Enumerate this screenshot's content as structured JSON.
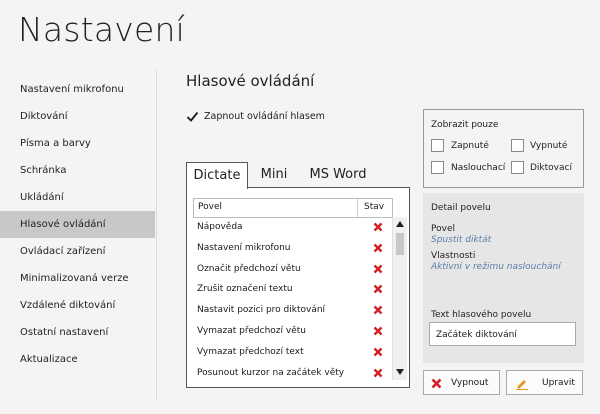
{
  "title": "Nastavení",
  "sidebar": {
    "items": [
      {
        "label": "Nastavení mikrofonu"
      },
      {
        "label": "Diktování"
      },
      {
        "label": "Písma a barvy"
      },
      {
        "label": "Schránka"
      },
      {
        "label": "Ukládání"
      },
      {
        "label": "Hlasové ovládání",
        "active": true
      },
      {
        "label": "Ovládací zařízení"
      },
      {
        "label": "Minimalizovaná verze"
      },
      {
        "label": "Vzdálené diktování"
      },
      {
        "label": "Ostatní nastavení"
      },
      {
        "label": "Aktualizace"
      }
    ]
  },
  "main": {
    "heading": "Hlasové ovládání",
    "enable_voice_label": "Zapnout ovládání hlasem",
    "enable_voice_checked": true,
    "tabs": [
      {
        "label": "Dictate",
        "active": true
      },
      {
        "label": "Mini"
      },
      {
        "label": "MS Word"
      }
    ],
    "table": {
      "columns": [
        "Povel",
        "Stav"
      ],
      "rows": [
        {
          "command": "Nápověda",
          "status": "disabled"
        },
        {
          "command": "Nastavení mikrofonu",
          "status": "disabled"
        },
        {
          "command": "Označit předchozí větu",
          "status": "disabled"
        },
        {
          "command": "Zrušit označení textu",
          "status": "disabled"
        },
        {
          "command": "Nastavit pozici pro diktování",
          "status": "disabled"
        },
        {
          "command": "Vymazat předchozí větu",
          "status": "disabled"
        },
        {
          "command": "Vymazat předchozí text",
          "status": "disabled"
        },
        {
          "command": "Posunout kurzor na začátek věty",
          "status": "disabled"
        }
      ]
    }
  },
  "filter": {
    "title": "Zobrazit pouze",
    "options": [
      {
        "label": "Zapnuté"
      },
      {
        "label": "Vypnuté"
      },
      {
        "label": "Naslouchací"
      },
      {
        "label": "Diktovací"
      }
    ]
  },
  "detail": {
    "title": "Detail povelu",
    "command_label": "Povel",
    "command_value": "Spustit diktát",
    "props_label": "Vlastnosti",
    "props_value": "Aktivní v režimu naslouchání",
    "text_label": "Text hlasového povelu",
    "text_value": "Začátek diktování"
  },
  "buttons": {
    "disable_label": "Vypnout",
    "edit_label": "Upravit"
  },
  "colors": {
    "accent_red": "#d0202a",
    "accent_orange": "#e39b1c",
    "italic_blue": "#5a7fa8"
  }
}
